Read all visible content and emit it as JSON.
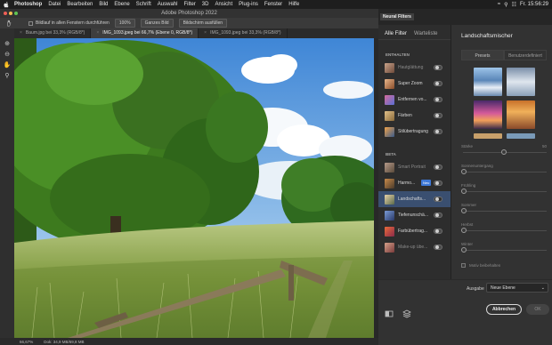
{
  "menubar": {
    "app_name": "Photoshop",
    "items": [
      "Datei",
      "Bearbeiten",
      "Bild",
      "Ebene",
      "Schrift",
      "Auswahl",
      "Filter",
      "3D",
      "Ansicht",
      "Plug-ins",
      "Fenster",
      "Hilfe"
    ],
    "clock": "Fr. 15:56:29"
  },
  "window": {
    "title": "Adobe Photoshop 2022"
  },
  "options": {
    "checkbox_label": "Bildlauf in allen Fenstern durchführen",
    "zoom_value": "100%",
    "fit_label": "Ganzes Bild",
    "fill_label": "Bildschirm ausfüllen"
  },
  "tabs": [
    {
      "label": "Baum.jpg bei 33,3% (RGB/8*)"
    },
    {
      "label": "IMG_1093.jpeg bei 66,7% (Ebene 0, RGB/8*)"
    },
    {
      "label": "IMG_1093.jpeg bei 33,3% (RGB/8*)"
    }
  ],
  "status": {
    "zoom": "66,67%",
    "doc": "Dok: 34,9 MB/69,8 MB"
  },
  "neural_filters": {
    "panel_title": "Neural Filters",
    "tabs": [
      "Alle Filter",
      "Warteliste"
    ],
    "sections": {
      "enthalten": {
        "title": "ENTHALTEN",
        "items": [
          {
            "name": "Hautglättung"
          },
          {
            "name": "Super Zoom"
          },
          {
            "name": "Entfernen vo..."
          },
          {
            "name": "Färben"
          },
          {
            "name": "Stilübertragung"
          }
        ]
      },
      "beta": {
        "title": "BETA",
        "items": [
          {
            "name": "Smart Portrait"
          },
          {
            "name": "Harmo...",
            "badge": "Neu"
          },
          {
            "name": "Landschafts..."
          },
          {
            "name": "Tiefenunschä..."
          },
          {
            "name": "Farbübertrag..."
          },
          {
            "name": "Make-up übe..."
          }
        ]
      }
    },
    "detail": {
      "title": "Landschaftsmischer",
      "subtabs": [
        "Presets",
        "Benutzerdefiniert"
      ],
      "sliders": [
        {
          "label": "Stärke",
          "value": "50"
        },
        {
          "label": "Sonnenuntergang",
          "value": "0"
        },
        {
          "label": "Frühling",
          "value": "0"
        },
        {
          "label": "Sommer",
          "value": "0"
        },
        {
          "label": "Herbst",
          "value": "0"
        },
        {
          "label": "Winter",
          "value": "0"
        }
      ],
      "checkbox": "Motiv beibehalten"
    },
    "output_label": "Ausgabe",
    "output_value": "Neue Ebene",
    "cancel_label": "Abbrechen",
    "ok_label": "OK"
  },
  "colors": {
    "accent": "#3d78d8",
    "selected_row": "#3a4f70"
  }
}
